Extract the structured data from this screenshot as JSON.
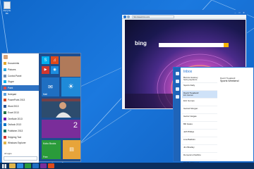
{
  "desktop": {
    "recycle_bin_label": "Recycle Bin"
  },
  "colors": {
    "accent": "#1e6fd0",
    "taskbar": "#0b2f5e",
    "desktop": "#1b79df"
  },
  "start_menu": {
    "user_name": "",
    "apps": [
      {
        "label": "Documents",
        "color": "#e0a72e"
      },
      {
        "label": "Pictures",
        "color": "#2aa9e0"
      },
      {
        "label": "Control Panel",
        "color": "#6b8fb8"
      },
      {
        "label": "Skype",
        "color": "#00aff0"
      },
      {
        "label": "Paint",
        "color": "#d9534f"
      },
      {
        "label": "Notepad",
        "color": "#5aa0e0"
      },
      {
        "label": "PowerPoint 2013",
        "color": "#d24726"
      },
      {
        "label": "Word 2013",
        "color": "#2b579a"
      },
      {
        "label": "Excel 2013",
        "color": "#217346"
      },
      {
        "label": "OneNote 2013",
        "color": "#7719aa"
      },
      {
        "label": "Outlook 2013",
        "color": "#0072c6"
      },
      {
        "label": "Publisher 2013",
        "color": "#077568"
      },
      {
        "label": "Snipping Tool",
        "color": "#c33"
      },
      {
        "label": "Windows Explorer",
        "color": "#e0b54b"
      }
    ],
    "all_apps_label": "All apps",
    "search_placeholder": "",
    "tiles": {
      "mail_label": "Mail",
      "people_label": "",
      "weather_label": "",
      "calendar_number": "2",
      "store_text": "Kobo Books",
      "store_caption": "Free"
    }
  },
  "ie": {
    "url": "http://www.bing.com",
    "bing_label": "bing"
  },
  "mail": {
    "folder_title": "Inbox",
    "messages": [
      {
        "from": "Bonnie Heaney",
        "preview": "Spring Appliance"
      },
      {
        "from": "Sports Daily",
        "preview": ""
      },
      {
        "from": "David Treadwell",
        "preview": "Eric Hansen"
      },
      {
        "from": "Eric Gomes",
        "preview": ""
      },
      {
        "from": "Garrett Morgan",
        "preview": ""
      },
      {
        "from": "Garret Vargas",
        "preview": ""
      },
      {
        "from": "Bill Gates",
        "preview": ""
      },
      {
        "from": "Jeff Phillips",
        "preview": ""
      },
      {
        "from": "Lisa Baldwin",
        "preview": ""
      },
      {
        "from": "Jim Bradley",
        "preview": ""
      },
      {
        "from": "Domenico Pacifico",
        "preview": ""
      },
      {
        "from": "Shelby Malovero",
        "preview": ""
      }
    ],
    "reading": {
      "from": "David Treadwell",
      "subject": "Sports Weekend",
      "body": ""
    }
  },
  "taskbar": {
    "clock": ""
  }
}
